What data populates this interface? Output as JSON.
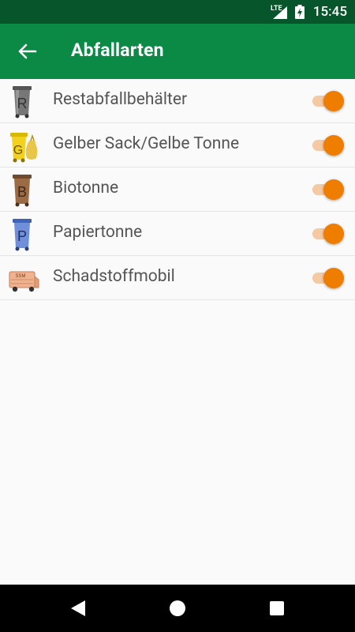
{
  "status_bar": {
    "time": "15:45",
    "network": "LTE",
    "icons": [
      "lte-signal-icon",
      "battery-charging-icon"
    ]
  },
  "app_bar": {
    "title": "Abfallarten",
    "back_icon": "arrow-back-icon",
    "color": "#0b8a45"
  },
  "waste_types": [
    {
      "label": "Restabfallbehälter",
      "icon": "restabfall-bin-icon",
      "letter": "R",
      "enabled": true
    },
    {
      "label": "Gelber Sack/Gelbe Tonne",
      "icon": "gelbe-tonne-icon",
      "letter": "G",
      "enabled": true
    },
    {
      "label": "Biotonne",
      "icon": "biotonne-icon",
      "letter": "B",
      "enabled": true
    },
    {
      "label": "Papiertonne",
      "icon": "papiertonne-icon",
      "letter": "P",
      "enabled": true
    },
    {
      "label": "Schadstoffmobil",
      "icon": "schadstoffmobil-truck-icon",
      "truck_text": "SSM",
      "enabled": true
    }
  ],
  "colors": {
    "toggle_on": "#ef7d00",
    "toggle_track": "#f4c9a3",
    "status_bar": "#07552a"
  },
  "nav_bar": {
    "icons": [
      "nav-back-icon",
      "nav-home-icon",
      "nav-recent-apps-icon"
    ]
  }
}
